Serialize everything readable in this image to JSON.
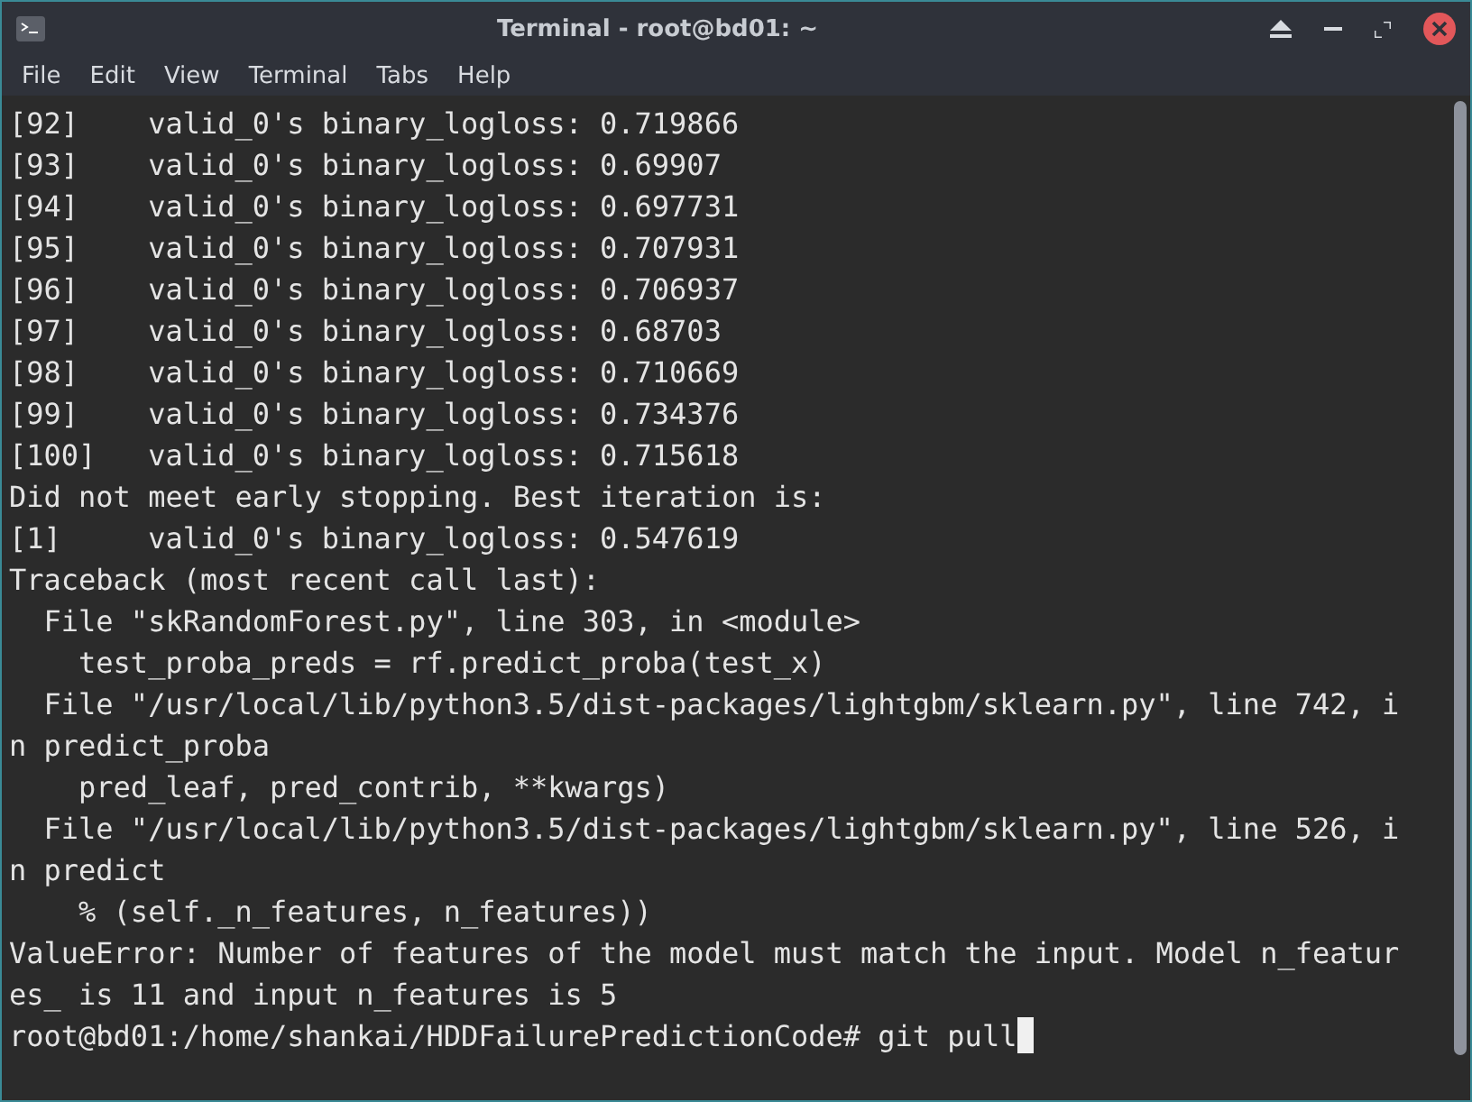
{
  "window": {
    "title": "Terminal - root@bd01: ~"
  },
  "menu": [
    "File",
    "Edit",
    "View",
    "Terminal",
    "Tabs",
    "Help"
  ],
  "terminal": {
    "cursor_visible": true,
    "lines": [
      "[92]    valid_0's binary_logloss: 0.719866",
      "[93]    valid_0's binary_logloss: 0.69907",
      "[94]    valid_0's binary_logloss: 0.697731",
      "[95]    valid_0's binary_logloss: 0.707931",
      "[96]    valid_0's binary_logloss: 0.706937",
      "[97]    valid_0's binary_logloss: 0.68703",
      "[98]    valid_0's binary_logloss: 0.710669",
      "[99]    valid_0's binary_logloss: 0.734376",
      "[100]   valid_0's binary_logloss: 0.715618",
      "Did not meet early stopping. Best iteration is:",
      "[1]     valid_0's binary_logloss: 0.547619",
      "Traceback (most recent call last):",
      "  File \"skRandomForest.py\", line 303, in <module>",
      "    test_proba_preds = rf.predict_proba(test_x)",
      "  File \"/usr/local/lib/python3.5/dist-packages/lightgbm/sklearn.py\", line 742, i",
      "n predict_proba",
      "    pred_leaf, pred_contrib, **kwargs)",
      "  File \"/usr/local/lib/python3.5/dist-packages/lightgbm/sklearn.py\", line 526, i",
      "n predict",
      "    % (self._n_features, n_features))",
      "ValueError: Number of features of the model must match the input. Model n_featur",
      "es_ is 11 and input n_features is 5",
      "root@bd01:/home/shankai/HDDFailurePredictionCode# git pull"
    ]
  }
}
